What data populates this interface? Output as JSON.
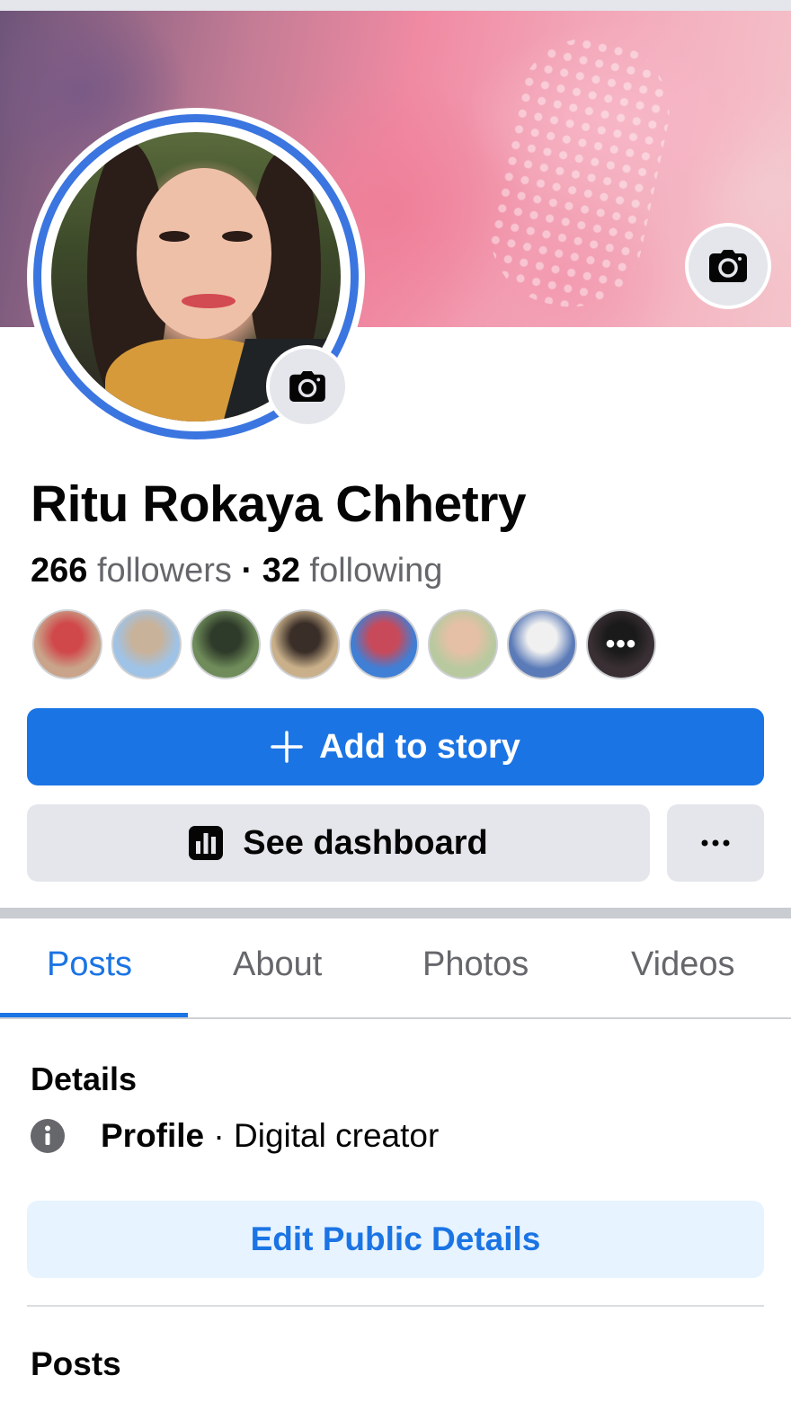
{
  "profile": {
    "name": "Ritu Rokaya Chhetry",
    "followers_count": "266",
    "followers_label": "followers",
    "separator": "·",
    "following_count": "32",
    "following_label": "following"
  },
  "friends": [
    {
      "color1": "#c9a48a",
      "color2": "#d0484a"
    },
    {
      "color1": "#9fc3e6",
      "color2": "#c9b29a"
    },
    {
      "color1": "#6f8c5a",
      "color2": "#2f3b2a"
    },
    {
      "color1": "#c9b08a",
      "color2": "#3a2e28"
    },
    {
      "color1": "#3f7fd6",
      "color2": "#c84a5a"
    },
    {
      "color1": "#b8c9a0",
      "color2": "#e6c0a6"
    },
    {
      "color1": "#5b7bb8",
      "color2": "#f0f0f0"
    },
    {
      "color1": "#3a3034",
      "color2": "#1a1a1a"
    }
  ],
  "more_label": "•••",
  "actions": {
    "add_story_icon": "plus-icon",
    "add_story_label": "Add to story",
    "dashboard_icon": "bar-chart-icon",
    "dashboard_label": "See dashboard",
    "more_icon": "ellipsis-icon"
  },
  "tabs": [
    {
      "label": "Posts",
      "active": true
    },
    {
      "label": "About",
      "active": false
    },
    {
      "label": "Photos",
      "active": false
    },
    {
      "label": "Videos",
      "active": false
    }
  ],
  "details": {
    "title": "Details",
    "icon": "info-icon",
    "row_label": "Profile",
    "row_separator": " · ",
    "row_value": "Digital creator",
    "edit_label": "Edit Public Details"
  },
  "posts": {
    "title": "Posts"
  },
  "colors": {
    "brand_blue": "#1b74e4",
    "button_gray": "#e4e6eb",
    "light_blue_bg": "#e7f3ff",
    "story_ring": "#3b75e0",
    "muted_text": "#65676b"
  }
}
